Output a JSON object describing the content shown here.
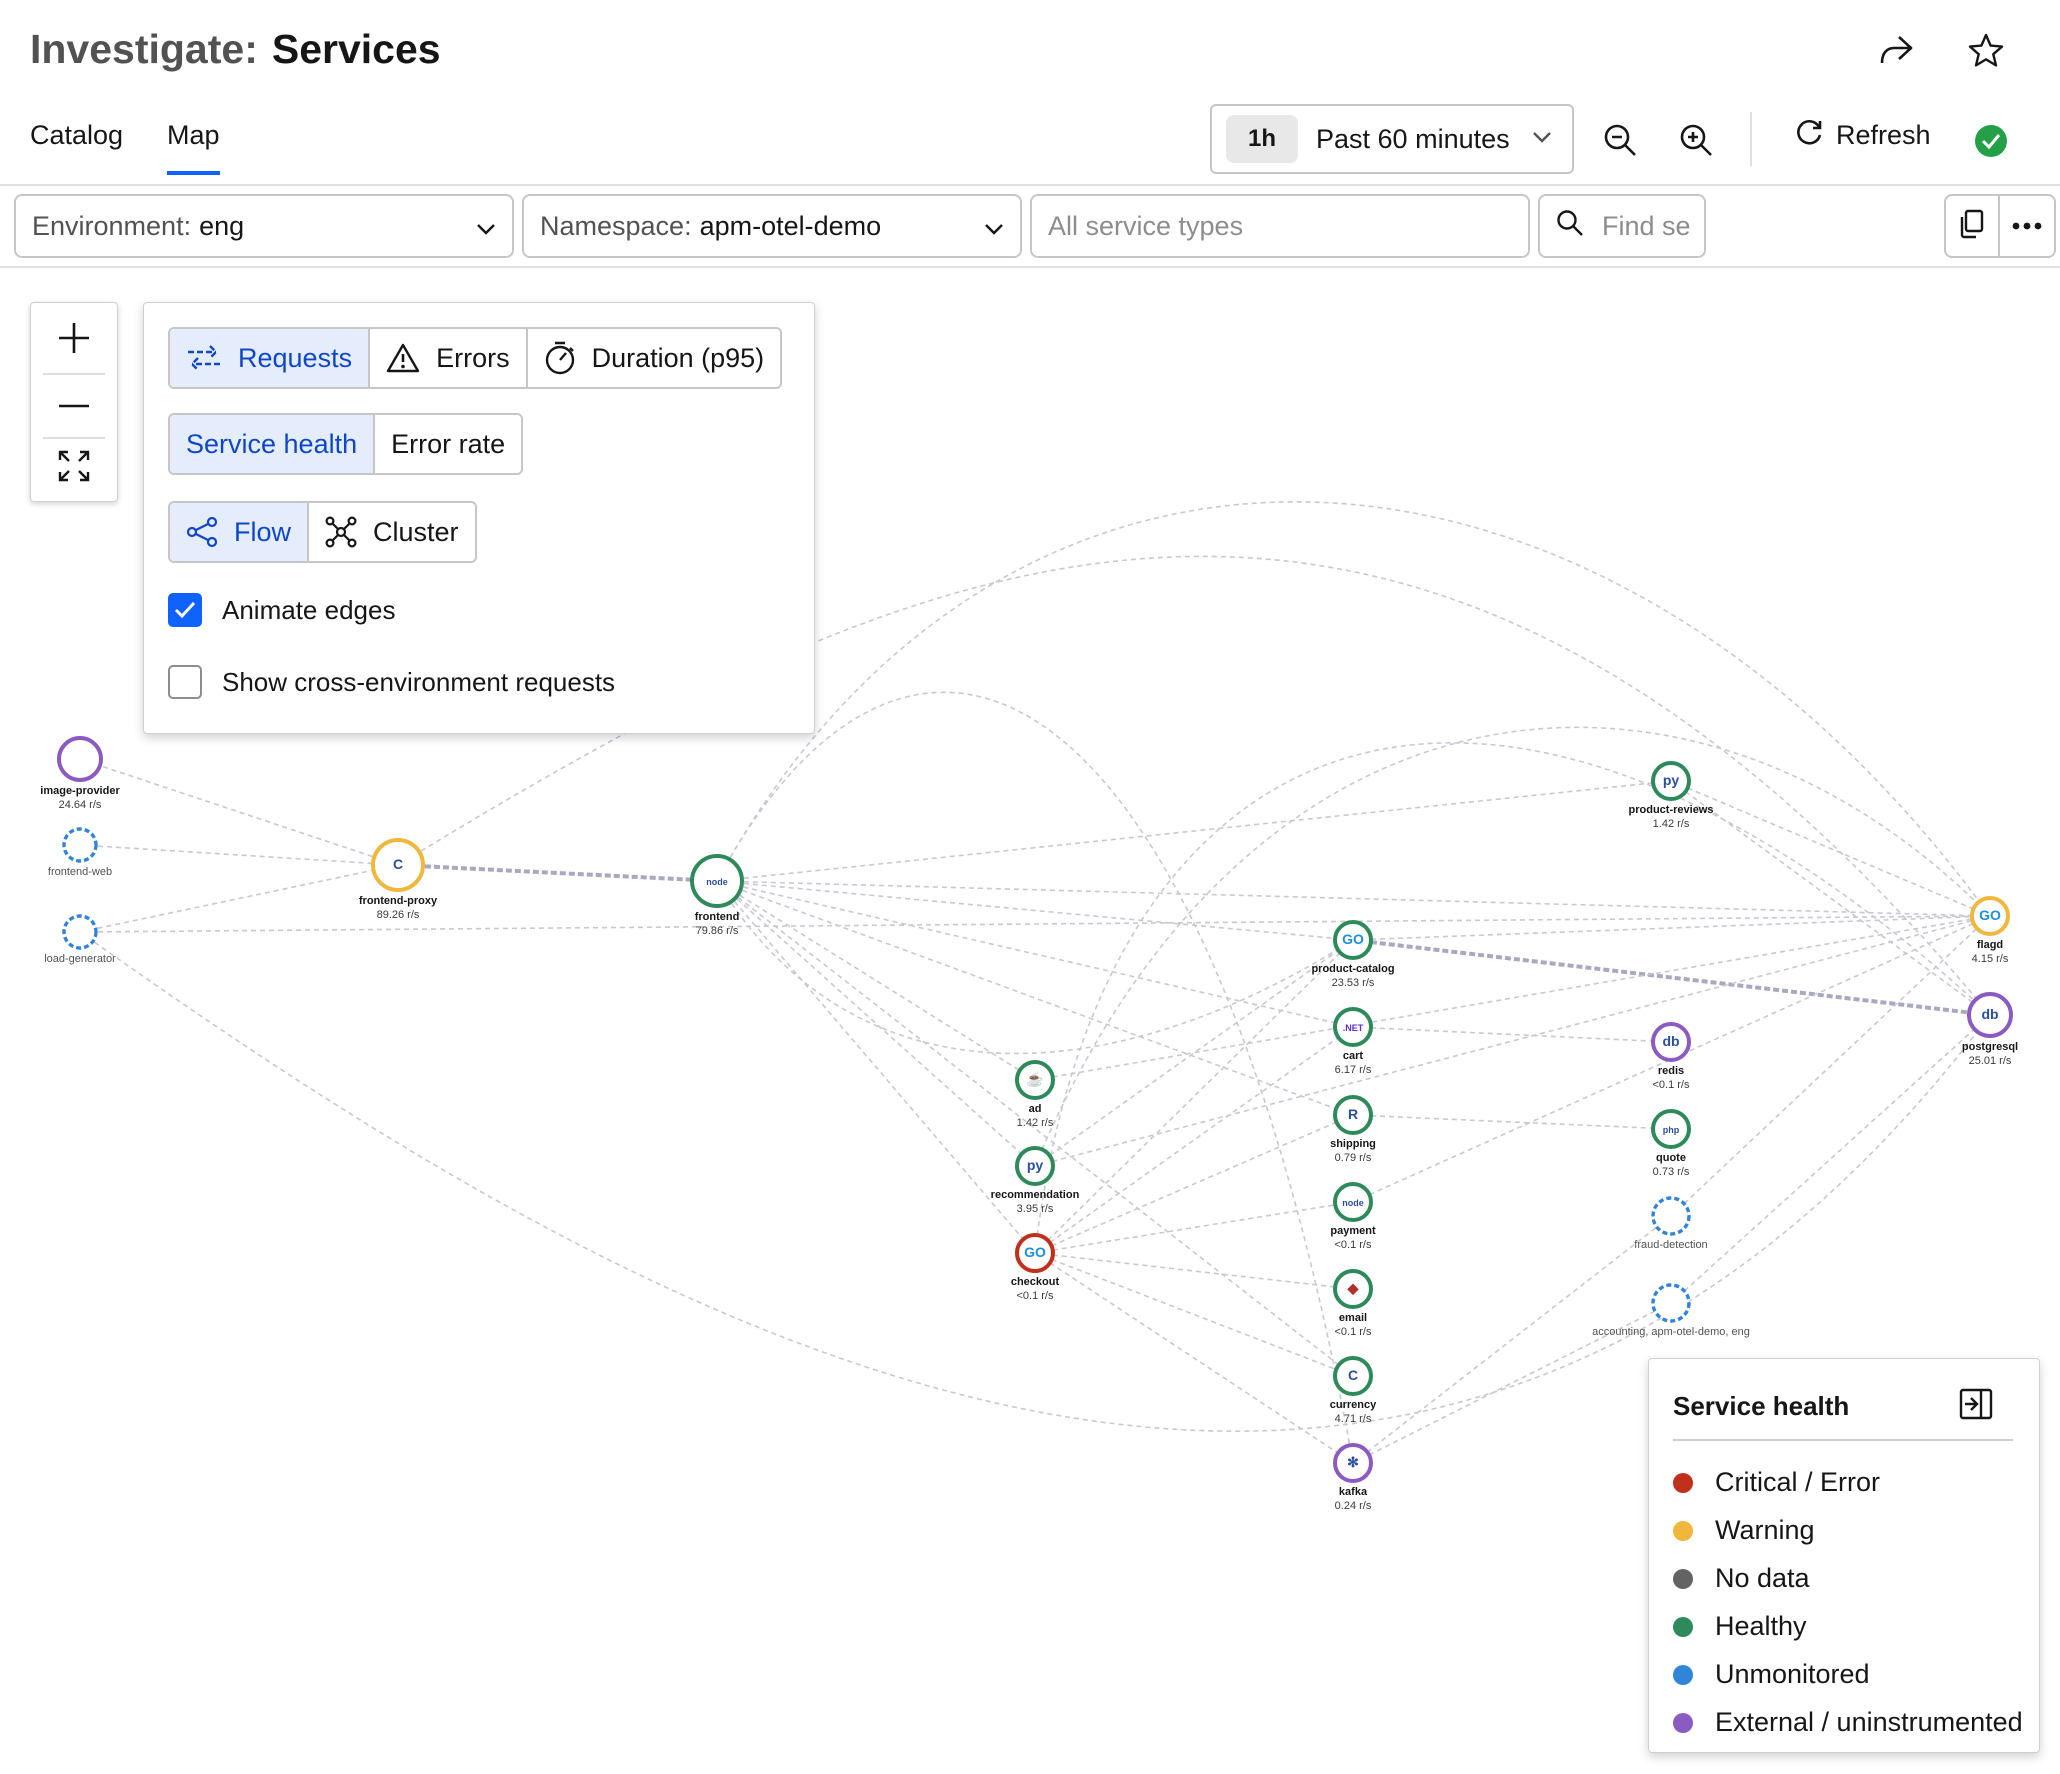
{
  "header": {
    "title_prefix": "Investigate:",
    "title_main": "Services"
  },
  "tabs": [
    {
      "label": "Catalog"
    },
    {
      "label": "Map",
      "active": true
    }
  ],
  "time_picker": {
    "chip": "1h",
    "label": "Past 60 minutes"
  },
  "toolbar": {
    "refresh_label": "Refresh",
    "status": "healthy"
  },
  "filters": {
    "environment": {
      "label": "Environment:",
      "value": "eng"
    },
    "namespace": {
      "label": "Namespace:",
      "value": "apm-otel-demo"
    },
    "service_types": {
      "placeholder": "All service types"
    },
    "find": {
      "placeholder": "Find se"
    }
  },
  "options": {
    "metrics": [
      {
        "label": "Requests",
        "selected": true
      },
      {
        "label": "Errors"
      },
      {
        "label": "Duration (p95)"
      }
    ],
    "coloring": [
      {
        "label": "Service health",
        "selected": true
      },
      {
        "label": "Error rate"
      }
    ],
    "layout": [
      {
        "label": "Flow",
        "selected": true
      },
      {
        "label": "Cluster"
      }
    ],
    "animate_edges": {
      "label": "Animate edges",
      "checked": true
    },
    "cross_env": {
      "label": "Show cross-environment requests",
      "checked": false
    }
  },
  "legend": {
    "title": "Service health",
    "items": [
      {
        "label": "Critical / Error",
        "color": "#c0301d"
      },
      {
        "label": "Warning",
        "color": "#f1b73c"
      },
      {
        "label": "No data",
        "color": "#636363"
      },
      {
        "label": "Healthy",
        "color": "#2e8a5a"
      },
      {
        "label": "Unmonitored",
        "color": "#3284d8"
      },
      {
        "label": "External / uninstrumented",
        "color": "#8a5bc0"
      }
    ]
  },
  "services": [
    {
      "id": "image-provider",
      "name": "image-provider",
      "rate": "24.64 r/s",
      "status": "external",
      "icon": "none"
    },
    {
      "id": "frontend-web",
      "name": "frontend-web",
      "rate": "",
      "status": "unmonitored",
      "icon": "none"
    },
    {
      "id": "load-generator",
      "name": "load-generator",
      "rate": "",
      "status": "unmonitored",
      "icon": "none"
    },
    {
      "id": "frontend-proxy",
      "name": "frontend-proxy",
      "rate": "89.26 r/s",
      "status": "warning",
      "icon": "cpp-icon",
      "glyph": "C"
    },
    {
      "id": "frontend",
      "name": "frontend",
      "rate": "79.86 r/s",
      "status": "healthy",
      "icon": "node-icon",
      "glyph": "node"
    },
    {
      "id": "ad",
      "name": "ad",
      "rate": "1.42 r/s",
      "status": "healthy",
      "icon": "java-icon",
      "glyph": "☕"
    },
    {
      "id": "recommendation",
      "name": "recommendation",
      "rate": "3.95 r/s",
      "status": "healthy",
      "icon": "python-icon",
      "glyph": "py"
    },
    {
      "id": "checkout",
      "name": "checkout",
      "rate": "<0.1 r/s",
      "status": "critical",
      "icon": "go-icon",
      "glyph": "GO"
    },
    {
      "id": "product-catalog",
      "name": "product-catalog",
      "rate": "23.53 r/s",
      "status": "healthy",
      "icon": "go-icon",
      "glyph": "GO"
    },
    {
      "id": "cart",
      "name": "cart",
      "rate": "6.17 r/s",
      "status": "healthy",
      "icon": "dotnet-icon",
      "glyph": ".NET"
    },
    {
      "id": "shipping",
      "name": "shipping",
      "rate": "0.79 r/s",
      "status": "healthy",
      "icon": "rust-icon",
      "glyph": "R"
    },
    {
      "id": "payment",
      "name": "payment",
      "rate": "<0.1 r/s",
      "status": "healthy",
      "icon": "node-icon",
      "glyph": "node"
    },
    {
      "id": "email",
      "name": "email",
      "rate": "<0.1 r/s",
      "status": "healthy",
      "icon": "ruby-icon",
      "glyph": "◆"
    },
    {
      "id": "currency",
      "name": "currency",
      "rate": "4.71 r/s",
      "status": "healthy",
      "icon": "cpp-icon",
      "glyph": "C"
    },
    {
      "id": "kafka",
      "name": "kafka",
      "rate": "0.24 r/s",
      "status": "external",
      "icon": "kafka-icon",
      "glyph": "✻"
    },
    {
      "id": "product-reviews",
      "name": "product-reviews",
      "rate": "1.42 r/s",
      "status": "healthy",
      "icon": "python-icon",
      "glyph": "py"
    },
    {
      "id": "redis",
      "name": "redis",
      "rate": "<0.1 r/s",
      "status": "external",
      "icon": "database-icon",
      "glyph": "db"
    },
    {
      "id": "quote",
      "name": "quote",
      "rate": "0.73 r/s",
      "status": "healthy",
      "icon": "php-icon",
      "glyph": "php"
    },
    {
      "id": "fraud-detection",
      "name": "fraud-detection",
      "rate": "",
      "status": "unmonitored",
      "icon": "none"
    },
    {
      "id": "accounting",
      "name": "accounting, apm-otel-demo, eng",
      "rate": "",
      "status": "unmonitored",
      "icon": "none"
    },
    {
      "id": "flagd",
      "name": "flagd",
      "rate": "4.15 r/s",
      "status": "warning",
      "icon": "go-icon",
      "glyph": "GO"
    },
    {
      "id": "postgresql",
      "name": "postgresql",
      "rate": "25.01 r/s",
      "status": "external",
      "icon": "database-icon",
      "glyph": "db"
    }
  ],
  "edges": [
    [
      "frontend-web",
      "frontend-proxy"
    ],
    [
      "load-generator",
      "frontend-proxy"
    ],
    [
      "frontend-proxy",
      "frontend"
    ],
    [
      "frontend-proxy",
      "image-provider"
    ],
    [
      "frontend",
      "product-catalog"
    ],
    [
      "frontend",
      "cart"
    ],
    [
      "frontend",
      "ad"
    ],
    [
      "frontend",
      "recommendation"
    ],
    [
      "frontend",
      "checkout"
    ],
    [
      "frontend",
      "shipping"
    ],
    [
      "frontend",
      "currency"
    ],
    [
      "frontend",
      "product-reviews"
    ],
    [
      "frontend",
      "flagd"
    ],
    [
      "product-catalog",
      "postgresql"
    ],
    [
      "product-catalog",
      "flagd"
    ],
    [
      "recommendation",
      "product-catalog"
    ],
    [
      "recommendation",
      "flagd"
    ],
    [
      "checkout",
      "cart"
    ],
    [
      "checkout",
      "shipping"
    ],
    [
      "checkout",
      "payment"
    ],
    [
      "checkout",
      "email"
    ],
    [
      "checkout",
      "currency"
    ],
    [
      "checkout",
      "kafka"
    ],
    [
      "checkout",
      "product-catalog"
    ],
    [
      "cart",
      "redis"
    ],
    [
      "shipping",
      "quote"
    ],
    [
      "kafka",
      "fraud-detection"
    ],
    [
      "kafka",
      "accounting"
    ],
    [
      "product-reviews",
      "postgresql"
    ],
    [
      "product-reviews",
      "flagd"
    ],
    [
      "ad",
      "flagd"
    ],
    [
      "load-generator",
      "flagd"
    ],
    [
      "accounting",
      "postgresql"
    ],
    [
      "fraud-detection",
      "flagd"
    ],
    [
      "payment",
      "flagd"
    ]
  ]
}
